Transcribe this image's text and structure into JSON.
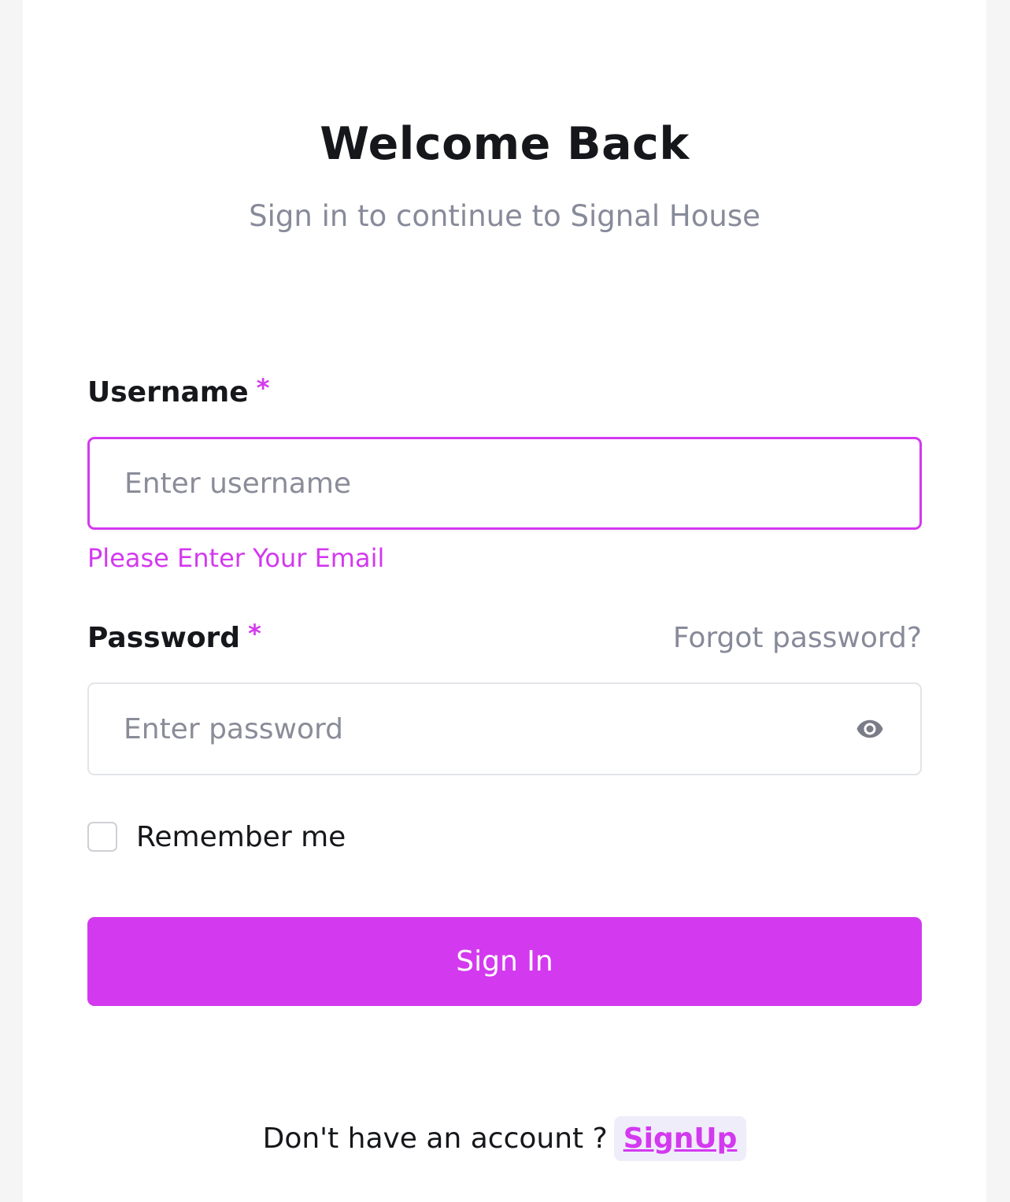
{
  "header": {
    "title": "Welcome Back",
    "subtitle": "Sign in to continue to Signal House"
  },
  "form": {
    "username": {
      "label": "Username",
      "required_mark": "*",
      "placeholder": "Enter username",
      "value": "",
      "error": "Please Enter Your Email"
    },
    "password": {
      "label": "Password",
      "required_mark": "*",
      "placeholder": "Enter password",
      "value": "",
      "forgot_link": "Forgot password?",
      "toggle_icon": "eye-icon"
    },
    "remember": {
      "label": "Remember me",
      "checked": false
    },
    "submit_label": "Sign In"
  },
  "footer": {
    "prompt": "Don't have an account ?",
    "signup_link": "SignUp"
  },
  "colors": {
    "accent": "#d339ef",
    "muted_text": "#878a99",
    "signup_bg": "#efedfa"
  }
}
